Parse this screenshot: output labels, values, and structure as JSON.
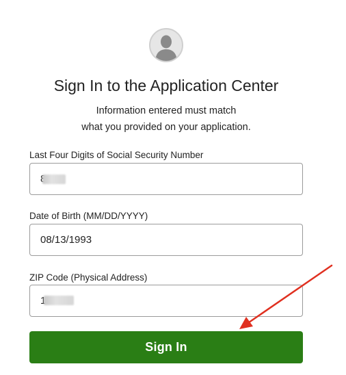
{
  "header": {
    "avatar_icon": "user-silhouette-icon",
    "title": "Sign In to the Application Center",
    "subtitle_line1": "Information entered must match",
    "subtitle_line2": "what you provided on your application."
  },
  "form": {
    "ssn": {
      "label": "Last Four Digits of Social Security Number",
      "value": "8"
    },
    "dob": {
      "label": "Date of Birth (MM/DD/YYYY)",
      "value": "08/13/1993"
    },
    "zip": {
      "label": "ZIP Code (Physical Address)",
      "value": "1"
    },
    "submit_label": "Sign In"
  },
  "annotation": {
    "arrow_color": "#e03020"
  },
  "colors": {
    "button": "#2a7e15",
    "field_border": "#9a9a9a"
  }
}
